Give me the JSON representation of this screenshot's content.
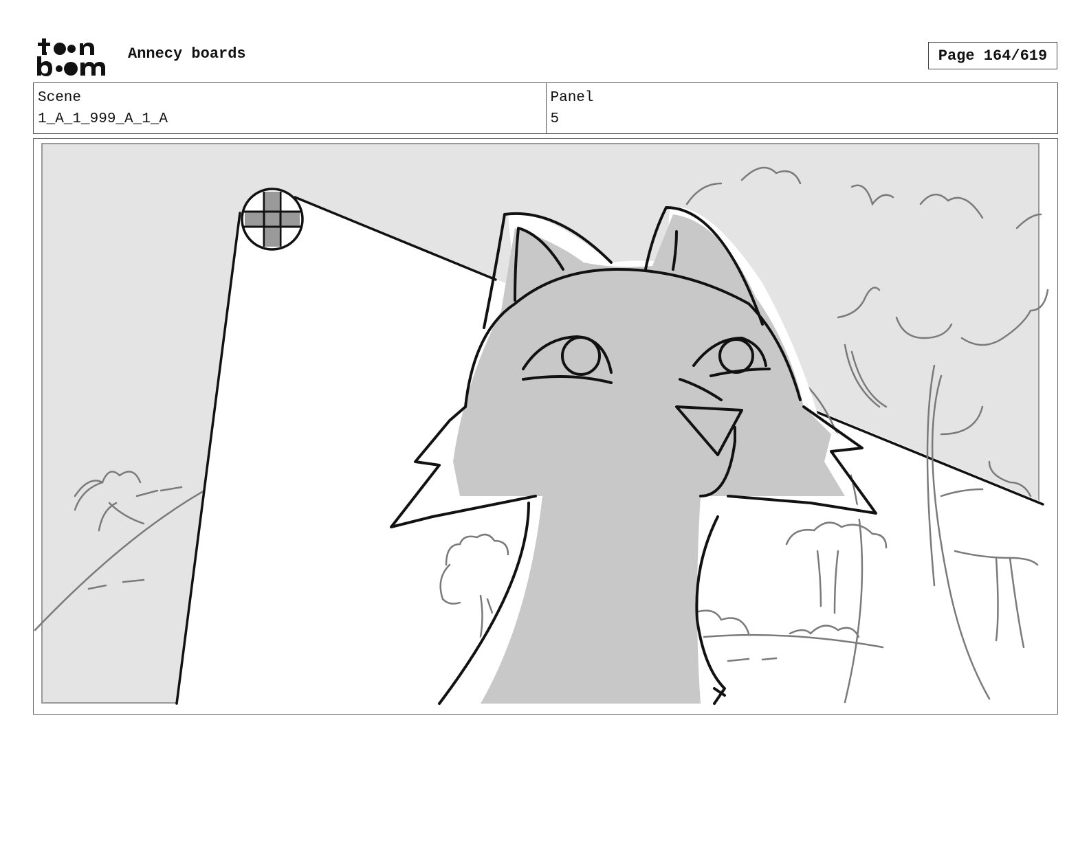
{
  "header": {
    "logo_text_top": "toon",
    "logo_text_bottom": "boom",
    "project_title": "Annecy boards",
    "page_indicator": "Page 164/619"
  },
  "info": {
    "scene_label": "Scene",
    "scene_value": "1_A_1_999_A_1_A",
    "panel_label": "Panel",
    "panel_value": "5"
  },
  "drawing": {
    "description_icons": [
      "spotlight-icon",
      "crosshair-icon",
      "cat-character",
      "palm-tree",
      "hills",
      "trees"
    ],
    "colors": {
      "sky": "#e4e4e4",
      "light_beam": "#ffffff",
      "cat_fill": "#c8c8c8",
      "lines": "#111111",
      "bg_lines": "#777777"
    }
  }
}
